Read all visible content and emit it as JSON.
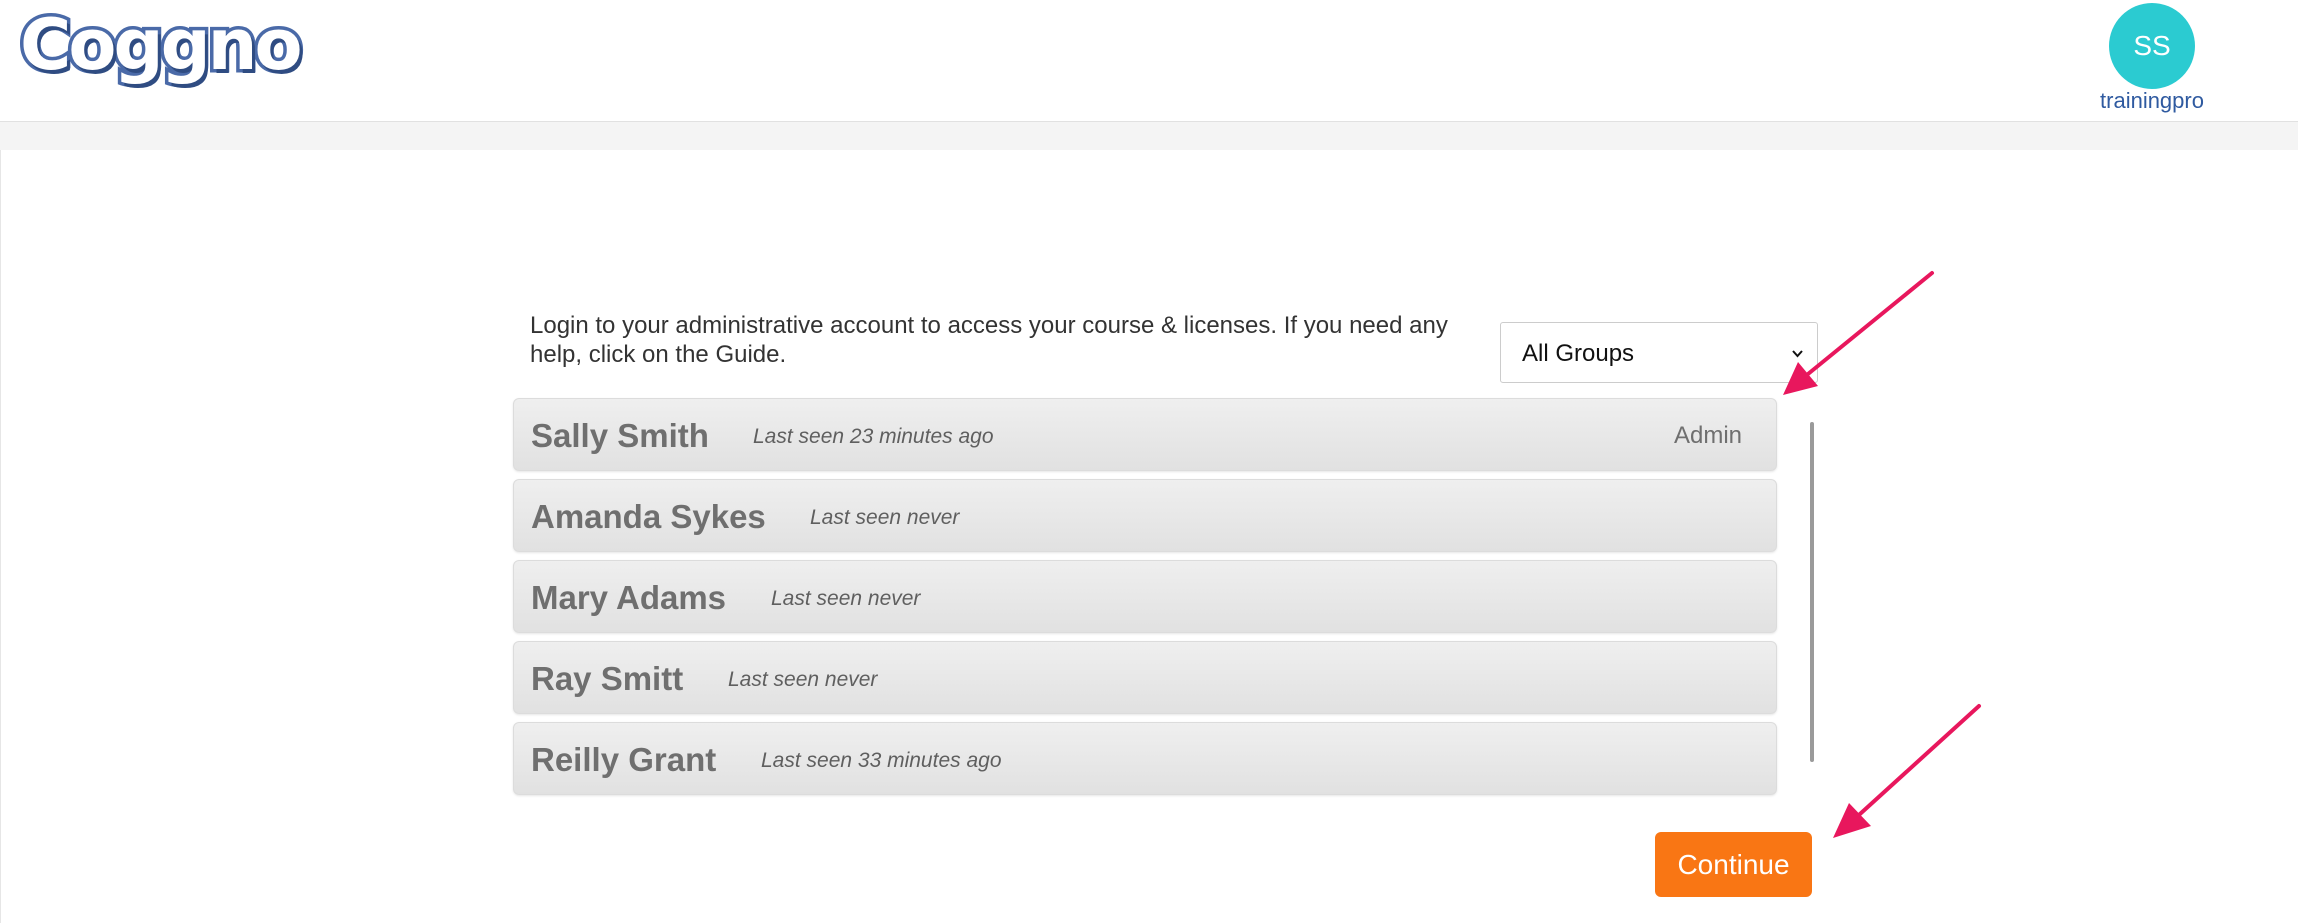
{
  "header": {
    "logo_text": "Coggno",
    "avatar_initials": "SS",
    "username": "trainingpro"
  },
  "login": {
    "intro_text": "Login to your administrative account to access your course & licenses. If you need any help, click on the Guide.",
    "group_select": {
      "selected": "All Groups"
    },
    "users": [
      {
        "name": "Sally Smith",
        "last_seen": "Last seen 23 minutes ago",
        "role": "Admin"
      },
      {
        "name": "Amanda Sykes",
        "last_seen": "Last seen never",
        "role": ""
      },
      {
        "name": "Mary Adams",
        "last_seen": "Last seen never",
        "role": ""
      },
      {
        "name": "Ray Smitt",
        "last_seen": "Last seen never",
        "role": ""
      },
      {
        "name": "Reilly Grant",
        "last_seen": "Last seen 33 minutes ago",
        "role": ""
      }
    ],
    "continue_label": "Continue"
  },
  "colors": {
    "avatar": "#2bcbd1",
    "username": "#2f5aa0",
    "continue_button": "#f97614",
    "annotation_arrow": "#e8175d",
    "logo_outline": "#4a6aa8"
  }
}
